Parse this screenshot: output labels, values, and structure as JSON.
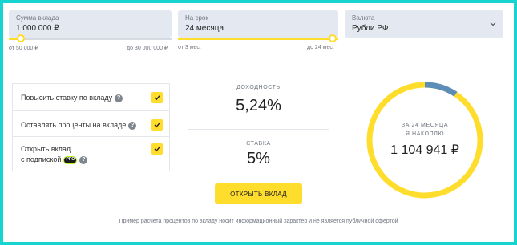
{
  "deposit_amount": {
    "label": "Сумма вклада",
    "value": "1 000 000 ₽",
    "min": "от 50 000 ₽",
    "max": "до 30 000 000 ₽"
  },
  "term": {
    "label": "На срок",
    "value": "24 месяца",
    "min": "от 3 мес.",
    "max": "до 24 мес."
  },
  "currency": {
    "label": "Валюта",
    "value": "Рубли РФ",
    "icon": "chevron-down-icon"
  },
  "options": [
    {
      "label": "Повысить ставку по вкладу",
      "checked": true
    },
    {
      "label": "Оставлять проценты на вкладе",
      "checked": true
    },
    {
      "label_line1": "Открыть вклад",
      "label_line2": "с подпиской",
      "badge": "PRO",
      "checked": true
    }
  ],
  "yield": {
    "label": "ДОХОДНОСТЬ",
    "value": "5,24%"
  },
  "rate": {
    "label": "СТАВКА",
    "value": "5%"
  },
  "open_button": "ОТКРЫТЬ ВКЛАД",
  "result": {
    "line1": "ЗА 24 МЕСЯЦА",
    "line2": "Я НАКОПЛЮ",
    "value": "1 104 941 ₽",
    "interest_fraction": 0.094
  },
  "disclaimer": "Пример расчета процентов по вкладу носит информационный характер и не является публичной офертой",
  "colors": {
    "accent": "#ffdd2d",
    "interest_arc": "#5b8db8",
    "frame": "#18d4d1"
  }
}
